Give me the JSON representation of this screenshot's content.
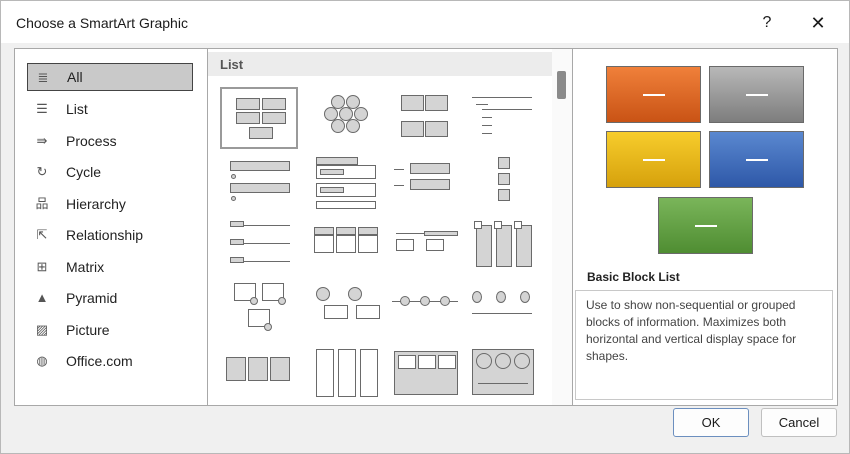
{
  "dialog": {
    "title": "Choose a SmartArt Graphic",
    "help_label": "?",
    "close_label": "✕"
  },
  "categories": [
    {
      "label": "All",
      "icon": "all-icon",
      "glyph": "≣"
    },
    {
      "label": "List",
      "icon": "list-icon",
      "glyph": "☰"
    },
    {
      "label": "Process",
      "icon": "process-icon",
      "glyph": "⇛"
    },
    {
      "label": "Cycle",
      "icon": "cycle-icon",
      "glyph": "↻"
    },
    {
      "label": "Hierarchy",
      "icon": "hierarchy-icon",
      "glyph": "品"
    },
    {
      "label": "Relationship",
      "icon": "relationship-icon",
      "glyph": "⇱"
    },
    {
      "label": "Matrix",
      "icon": "matrix-icon",
      "glyph": "⊞"
    },
    {
      "label": "Pyramid",
      "icon": "pyramid-icon",
      "glyph": "▲"
    },
    {
      "label": "Picture",
      "icon": "picture-icon",
      "glyph": "▨"
    },
    {
      "label": "Office.com",
      "icon": "globe-icon",
      "glyph": "◍"
    }
  ],
  "selected_category": "All",
  "gallery": {
    "header": "List",
    "selected_layout": "Basic Block List"
  },
  "preview": {
    "name": "Basic Block List",
    "description": "Use to show non-sequential or grouped blocks of information. Maximizes both horizontal and vertical display space for shapes.",
    "colors": [
      "#e06a26",
      "#9a9a9a",
      "#eab61a",
      "#3f6fbf",
      "#66a246"
    ]
  },
  "buttons": {
    "ok": "OK",
    "cancel": "Cancel"
  }
}
